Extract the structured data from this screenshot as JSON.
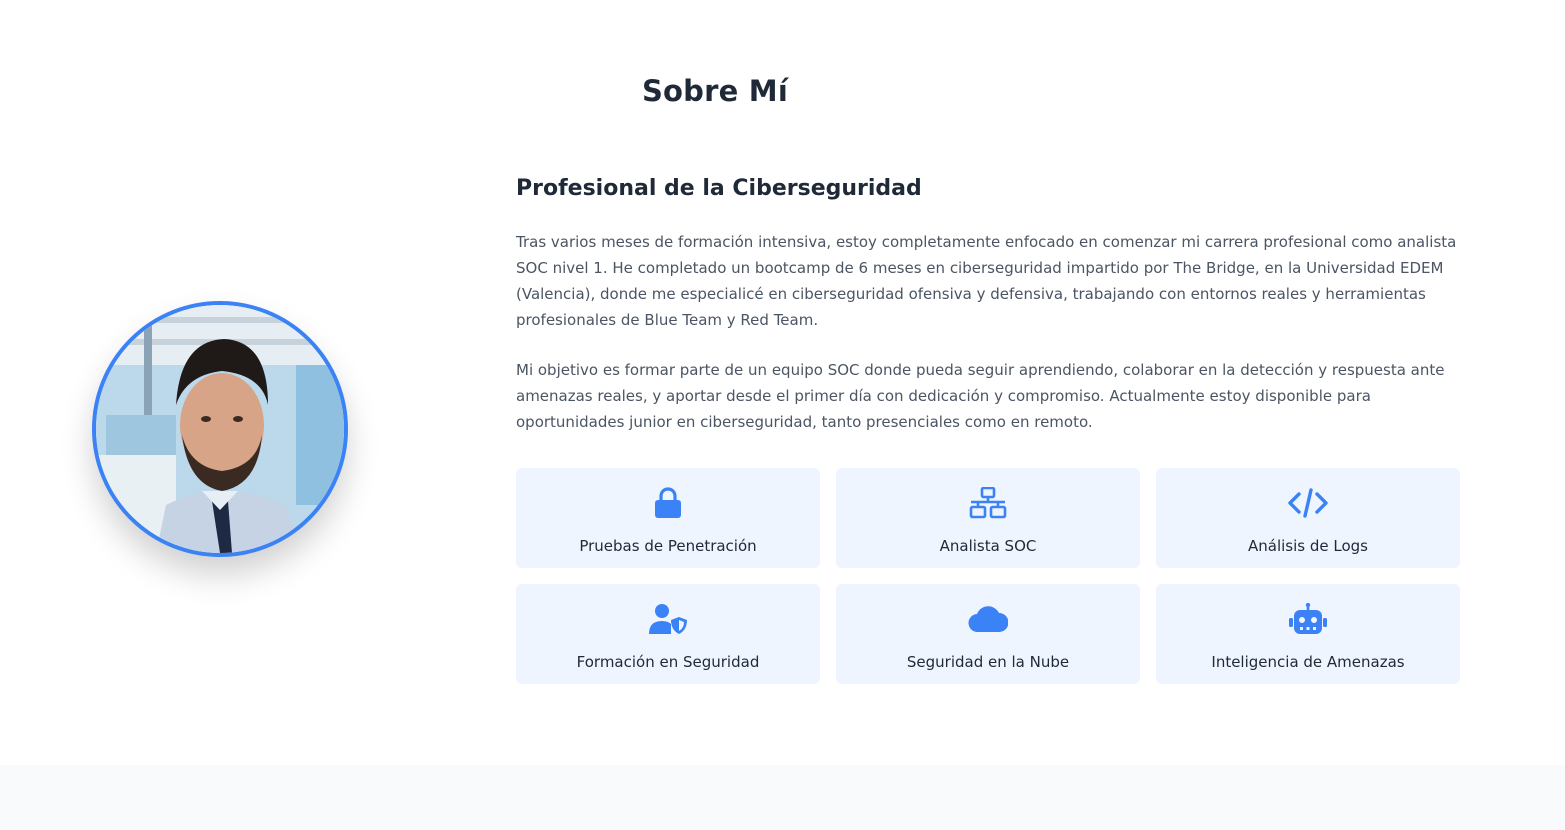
{
  "about": {
    "title": "Sobre Mí",
    "subtitle": "Profesional de la Ciberseguridad",
    "paragraph_1": "Tras varios meses de formación intensiva, estoy completamente enfocado en comenzar mi carrera profesional como analista SOC nivel 1. He completado un bootcamp de 6 meses en ciberseguridad impartido por The Bridge, en la Universidad EDEM (Valencia), donde me especialicé en ciberseguridad ofensiva y defensiva, trabajando con entornos reales y herramientas profesionales de Blue Team y Red Team.",
    "paragraph_2": "Mi objetivo es formar parte de un equipo SOC donde pueda seguir aprendiendo, colaborar en la detección y respuesta ante amenazas reales, y aportar desde el primer día con dedicación y compromiso. Actualmente estoy disponible para oportunidades junior en ciberseguridad, tanto presenciales como en remoto."
  },
  "skills": [
    {
      "label": "Pruebas de Penetración",
      "icon": "lock-icon"
    },
    {
      "label": "Analista SOC",
      "icon": "network-icon"
    },
    {
      "label": "Análisis de Logs",
      "icon": "code-icon"
    },
    {
      "label": "Formación en Seguridad",
      "icon": "user-shield-icon"
    },
    {
      "label": "Seguridad en la Nube",
      "icon": "cloud-icon"
    },
    {
      "label": "Inteligencia de Amenazas",
      "icon": "robot-icon"
    }
  ],
  "colors": {
    "accent": "#3b82f6",
    "card_bg": "#eef5ff",
    "text_dark": "#1f2937",
    "text_body": "#4b5563"
  }
}
